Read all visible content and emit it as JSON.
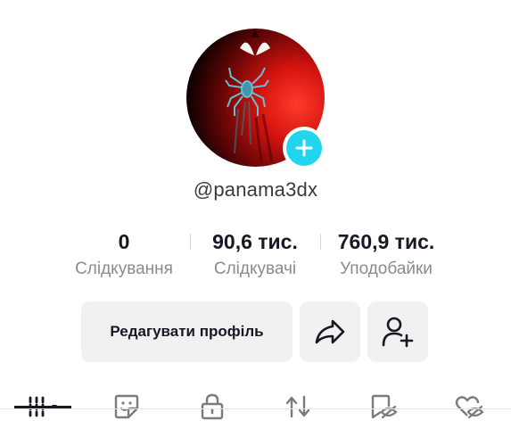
{
  "profile": {
    "username": "@panama3dx",
    "avatar_icon": "spider-emblem-icon",
    "add_badge_icon": "plus-icon",
    "accent_color": "#20d5ec"
  },
  "stats": [
    {
      "value": "0",
      "label": "Слідкування"
    },
    {
      "value": "90,6 тис.",
      "label": "Слідкувачі"
    },
    {
      "value": "760,9 тис.",
      "label": "Уподобайки"
    }
  ],
  "actions": {
    "edit_label": "Редагувати профіль",
    "share_icon": "share-arrow-icon",
    "add_friend_icon": "add-friend-icon"
  },
  "tabs": [
    {
      "icon": "grid-videos-icon",
      "active": true
    },
    {
      "icon": "sticker-icon",
      "active": false
    },
    {
      "icon": "lock-icon",
      "active": false
    },
    {
      "icon": "repost-icon",
      "active": false
    },
    {
      "icon": "hidden-bookmark-icon",
      "active": false
    },
    {
      "icon": "hidden-heart-icon",
      "active": false
    }
  ]
}
